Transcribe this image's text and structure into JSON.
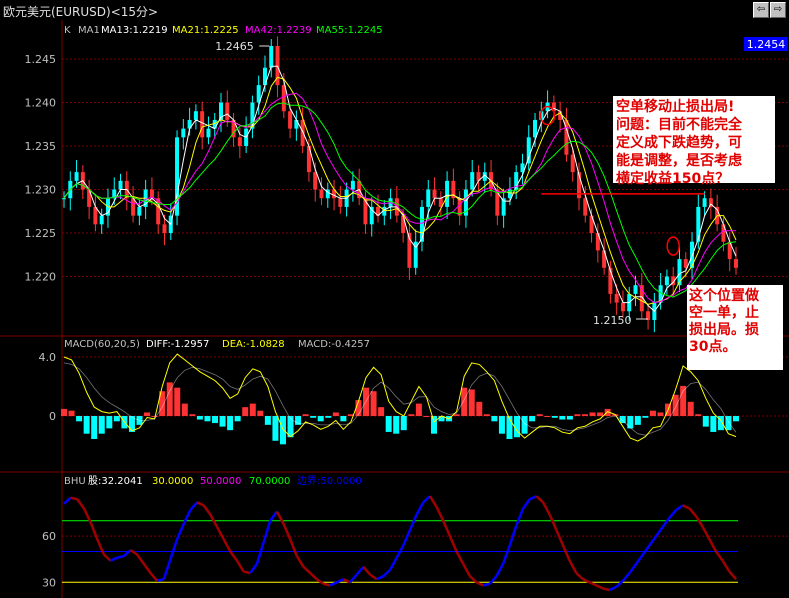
{
  "window": {
    "title": "欧元美元(EURUSD)<15分>"
  },
  "nav": {
    "prev": "⇦",
    "next": "⇨",
    "close": "▣"
  },
  "colors": {
    "up": "#00ffff",
    "down": "#ff3333",
    "ma13": "#ffffff",
    "ma21": "#ffff00",
    "ma42": "#ff00ff",
    "ma55": "#00ff00",
    "diff": "#ffffff",
    "dea": "#ffff00",
    "grid": "#800000",
    "red_line": "#ff0000",
    "bhu_up": "#0000ff",
    "bhu_down": "#a00000"
  },
  "main_panel": {
    "legend": [
      "K",
      "MA1",
      "MA13:1.2219",
      "MA21:1.2225",
      "MA42:1.2239",
      "MA55:1.2245"
    ],
    "ytick_labels": [
      "1.245",
      "1.240",
      "1.235",
      "1.230",
      "1.225",
      "1.220"
    ],
    "last_price": "1.2454",
    "high_label": "1.2465",
    "low_label": "1.2150",
    "annotation_top": [
      "空单移动止损出局!",
      "问题：目前不能完全",
      "定义成下跌趋势，可",
      "能是调整，是否考虑",
      "横定收益150点？"
    ],
    "annotation_bottom": [
      "这个位置做",
      "空一单，止",
      "损出局。损",
      "30点。"
    ]
  },
  "macd_panel": {
    "legend": [
      "MACD(60,20,5)",
      "DIFF:-1.2957",
      "DEA:-1.0828",
      "MACD:-0.4257"
    ],
    "ytick_labels": [
      "4.0",
      "0"
    ]
  },
  "bhu_panel": {
    "legend": [
      "BHU",
      "股:32.2041",
      "30.0000",
      "50.0000",
      "70.0000",
      "边界:50.0000"
    ],
    "ytick_labels": [
      "60",
      "30"
    ]
  },
  "chart_data": [
    {
      "type": "candlestick",
      "title": "欧元美元(EURUSD)<15分>",
      "ylim": [
        1.215,
        1.2465
      ],
      "yticks": [
        1.245,
        1.24,
        1.235,
        1.23,
        1.225,
        1.22
      ],
      "close": [
        1.229,
        1.231,
        1.232,
        1.23,
        1.228,
        1.226,
        1.227,
        1.229,
        1.23,
        1.231,
        1.229,
        1.227,
        1.228,
        1.23,
        1.229,
        1.226,
        1.225,
        1.227,
        1.236,
        1.237,
        1.238,
        1.239,
        1.236,
        1.237,
        1.238,
        1.24,
        1.238,
        1.236,
        1.235,
        1.237,
        1.24,
        1.242,
        1.244,
        1.2465,
        1.242,
        1.239,
        1.237,
        1.238,
        1.235,
        1.232,
        1.23,
        1.229,
        1.23,
        1.229,
        1.228,
        1.23,
        1.231,
        1.229,
        1.226,
        1.228,
        1.227,
        1.228,
        1.229,
        1.227,
        1.225,
        1.221,
        1.224,
        1.228,
        1.23,
        1.229,
        1.228,
        1.231,
        1.229,
        1.227,
        1.23,
        1.232,
        1.231,
        1.232,
        1.23,
        1.227,
        1.229,
        1.23,
        1.232,
        1.233,
        1.236,
        1.238,
        1.239,
        1.24,
        1.239,
        1.238,
        1.234,
        1.232,
        1.229,
        1.227,
        1.225,
        1.223,
        1.221,
        1.218,
        1.217,
        1.216,
        1.218,
        1.219,
        1.216,
        1.215,
        1.217,
        1.219,
        1.22,
        1.219,
        1.222,
        1.221,
        1.224,
        1.228,
        1.229,
        1.228,
        1.226,
        1.224,
        1.222,
        1.221
      ],
      "ma_labels": [
        "MA13:1.2219",
        "MA21:1.2225",
        "MA42:1.2239",
        "MA55:1.2245"
      ],
      "annotations": [
        "1.2465",
        "1.2150"
      ],
      "reference_line": 1.2295
    },
    {
      "type": "line",
      "title": "MACD(60,20,5)",
      "ylim": [
        -1.8,
        4.4
      ],
      "yticks": [
        4.0,
        0
      ],
      "series": [
        {
          "name": "DIFF",
          "values": [
            4.0,
            3.8,
            2.9,
            1.6,
            0.6,
            0.3,
            0.2,
            0.3,
            -0.4,
            -1.0,
            -0.8,
            -0.1,
            -0.2,
            2.0,
            3.6,
            4.2,
            3.8,
            3.4,
            3.0,
            2.7,
            2.4,
            1.9,
            1.2,
            1.5,
            2.6,
            3.2,
            3.0,
            2.0,
            0.3,
            -0.9,
            -1.4,
            -1.0,
            -0.4,
            -0.6,
            -0.9,
            -0.7,
            -0.3,
            -0.9,
            -0.4,
            1.0,
            2.6,
            3.3,
            2.8,
            1.0,
            0.3,
            0.0,
            1.0,
            2.0,
            1.3,
            -0.4,
            0.0,
            -0.2,
            0.3,
            2.7,
            3.6,
            3.5,
            3.0,
            2.4,
            1.0,
            -0.2,
            -1.0,
            -1.5,
            -1.1,
            -0.7,
            -0.7,
            -0.8,
            -1.1,
            -1.2,
            -0.8,
            -0.7,
            -0.4,
            -0.2,
            0.3,
            0.1,
            -0.7,
            -1.5,
            -1.7,
            -1.4,
            -0.8,
            -0.7,
            0.4,
            1.8,
            3.4,
            3.0,
            2.4,
            1.2,
            0.2,
            -0.3,
            -1.2,
            -1.4
          ]
        },
        {
          "name": "DEA",
          "values": [
            3.6,
            3.5,
            3.2,
            2.6,
            1.9,
            1.3,
            0.9,
            0.6,
            0.3,
            -0.1,
            -0.3,
            -0.3,
            -0.2,
            0.6,
            1.7,
            2.6,
            3.1,
            3.3,
            3.2,
            3.0,
            2.8,
            2.5,
            2.0,
            1.8,
            2.1,
            2.5,
            2.7,
            2.5,
            1.7,
            0.7,
            -0.2,
            -0.5,
            -0.5,
            -0.5,
            -0.6,
            -0.6,
            -0.5,
            -0.6,
            -0.5,
            0.1,
            1.0,
            1.9,
            2.3,
            1.9,
            1.3,
            0.8,
            0.9,
            1.3,
            1.3,
            0.6,
            0.3,
            0.1,
            0.2,
            1.1,
            2.1,
            2.7,
            2.9,
            2.7,
            2.0,
            1.1,
            0.2,
            -0.5,
            -0.8,
            -0.8,
            -0.7,
            -0.7,
            -0.9,
            -1.0,
            -0.9,
            -0.8,
            -0.6,
            -0.4,
            -0.1,
            0.0,
            -0.3,
            -0.8,
            -1.2,
            -1.3,
            -1.1,
            -0.9,
            -0.3,
            0.6,
            1.7,
            2.2,
            2.3,
            1.8,
            1.1,
            0.5,
            -0.4,
            -1.1
          ]
        }
      ],
      "legend": [
        "DIFF:-1.2957",
        "DEA:-1.0828",
        "MACD:-0.4257"
      ]
    },
    {
      "type": "line",
      "title": "BHU",
      "ylim": [
        25,
        90
      ],
      "yticks": [
        60,
        30
      ],
      "reference_lines": [
        30,
        50,
        70
      ],
      "series": [
        {
          "name": "股",
          "values": [
            81,
            85,
            84,
            78,
            69,
            58,
            48,
            44,
            46,
            47,
            51,
            48,
            42,
            36,
            31,
            32,
            45,
            58,
            68,
            77,
            82,
            80,
            74,
            66,
            58,
            50,
            44,
            37,
            36,
            42,
            56,
            70,
            76,
            68,
            58,
            47,
            40,
            36,
            32,
            29,
            28,
            30,
            32,
            30,
            35,
            40,
            35,
            32,
            34,
            38,
            46,
            54,
            64,
            74,
            82,
            86,
            79,
            70,
            60,
            50,
            42,
            34,
            30,
            28,
            29,
            34,
            42,
            54,
            67,
            78,
            84,
            86,
            82,
            74,
            64,
            54,
            44,
            36,
            32,
            30,
            28,
            26,
            25,
            27,
            31,
            36,
            42,
            48,
            54,
            60,
            66,
            72,
            77,
            80,
            78,
            73,
            66,
            58,
            50,
            44,
            37,
            32
          ]
        }
      ],
      "legend": [
        "股:32.2041",
        "30.0000",
        "50.0000",
        "70.0000",
        "边界:50.0000"
      ]
    }
  ]
}
